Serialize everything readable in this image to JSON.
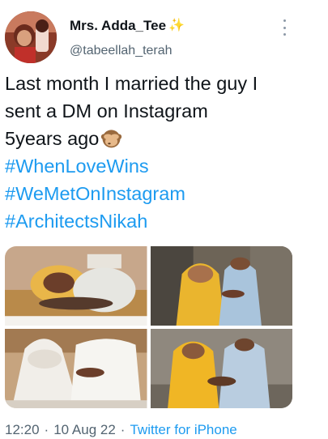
{
  "author": {
    "display_name": "Mrs. Adda_Tee",
    "badge_icon": "sparkles-icon",
    "handle": "@tabeellah_terah",
    "avatar_icon": "profile-photo"
  },
  "tweet": {
    "lines": [
      "Last month I married the guy I",
      "sent a DM on Instagram",
      "5years ago"
    ],
    "emoji_icon": "see-no-evil-monkey-icon",
    "hashtags": [
      "#WhenLoveWins",
      "#WeMetOnInstagram",
      "#ArchitectsNikah"
    ],
    "hashtag_color": "#1d9bf0"
  },
  "media": {
    "photos": [
      "wedding-photo-1",
      "wedding-photo-2",
      "wedding-photo-3",
      "wedding-photo-4"
    ]
  },
  "meta": {
    "time": "12:20",
    "separator": "·",
    "date": "10 Aug 22",
    "source": "Twitter for iPhone"
  },
  "colors": {
    "text": "#0f1419",
    "secondary": "#536471",
    "accent": "#1d9bf0"
  }
}
